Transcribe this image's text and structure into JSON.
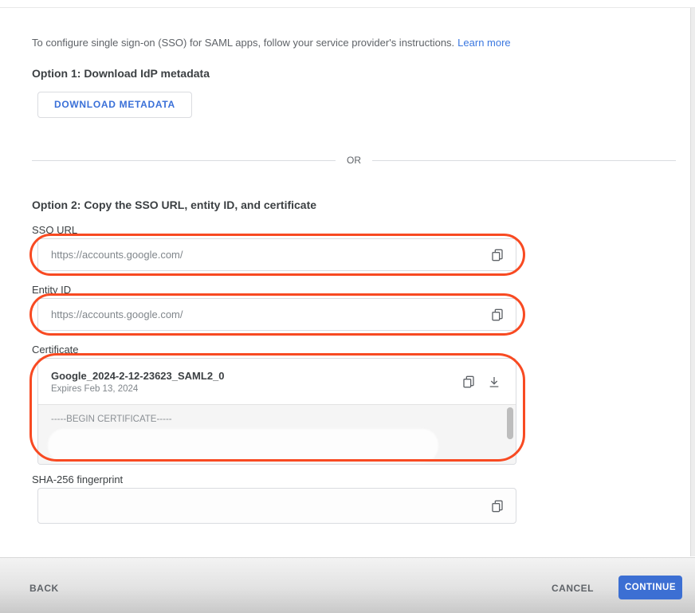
{
  "intro": {
    "text": "To configure single sign-on (SSO) for SAML apps, follow your service provider's instructions.",
    "link": "Learn more"
  },
  "option1": {
    "heading": "Option 1: Download IdP metadata",
    "download_button": "DOWNLOAD METADATA"
  },
  "divider": {
    "label": "OR"
  },
  "option2": {
    "heading": "Option 2: Copy the SSO URL, entity ID, and certificate"
  },
  "fields": {
    "sso": {
      "label": "SSO URL",
      "value": "https://accounts.google.com/"
    },
    "entity": {
      "label": "Entity ID",
      "value": "https://accounts.google.com/"
    },
    "certificate": {
      "label": "Certificate",
      "name": "Google_2024-2-12-23623_SAML2_0",
      "expires": "Expires Feb 13, 2024",
      "body_first_line": "-----BEGIN CERTIFICATE-----"
    },
    "sha": {
      "label": "SHA-256 fingerprint",
      "value": ""
    }
  },
  "icons": {
    "copy": "copy-icon",
    "download": "download-icon"
  },
  "footer": {
    "back": "BACK",
    "cancel": "CANCEL",
    "continue": "CONTINUE"
  },
  "colors": {
    "accent_blue": "#3c6fd3",
    "link_blue": "#3b78e0",
    "annotation_red": "#f84a22"
  }
}
